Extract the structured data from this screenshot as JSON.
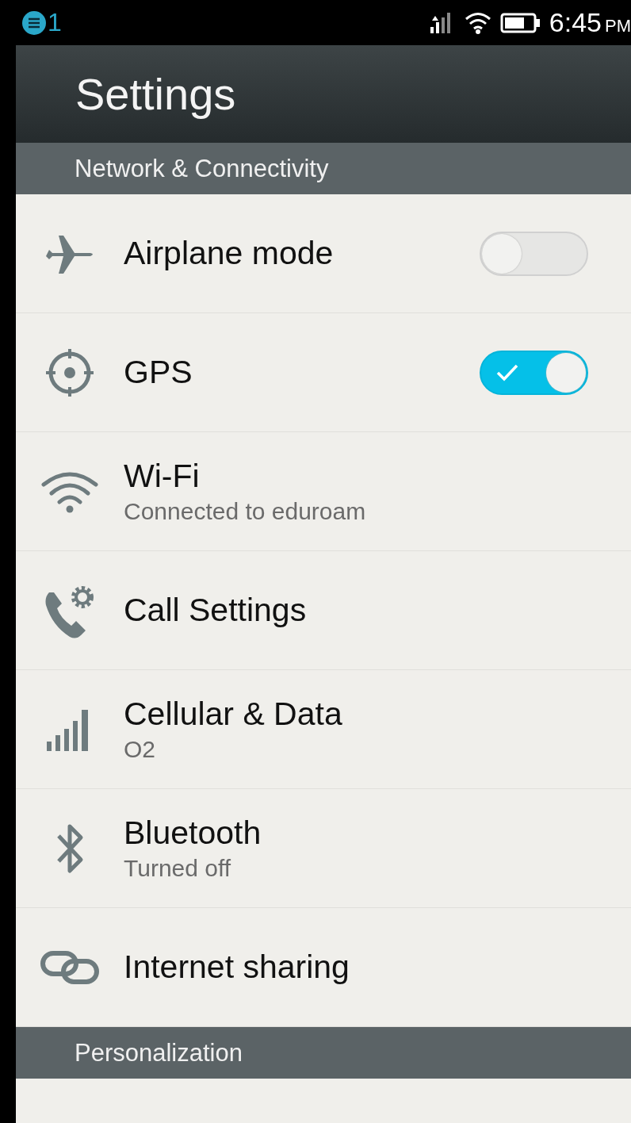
{
  "status_bar": {
    "notification_count": "1",
    "time": "6:45",
    "meridiem": "PM"
  },
  "header": {
    "title": "Settings"
  },
  "sections": [
    {
      "title": "Network & Connectivity",
      "items": [
        {
          "kind": "toggle",
          "label": "Airplane mode",
          "on": false
        },
        {
          "kind": "toggle",
          "label": "GPS",
          "on": true
        },
        {
          "kind": "link",
          "label": "Wi-Fi",
          "subtitle": "Connected to eduroam"
        },
        {
          "kind": "link",
          "label": "Call Settings"
        },
        {
          "kind": "link",
          "label": "Cellular & Data",
          "subtitle": "O2"
        },
        {
          "kind": "link",
          "label": "Bluetooth",
          "subtitle": "Turned off"
        },
        {
          "kind": "link",
          "label": "Internet sharing"
        }
      ]
    },
    {
      "title": "Personalization"
    }
  ]
}
